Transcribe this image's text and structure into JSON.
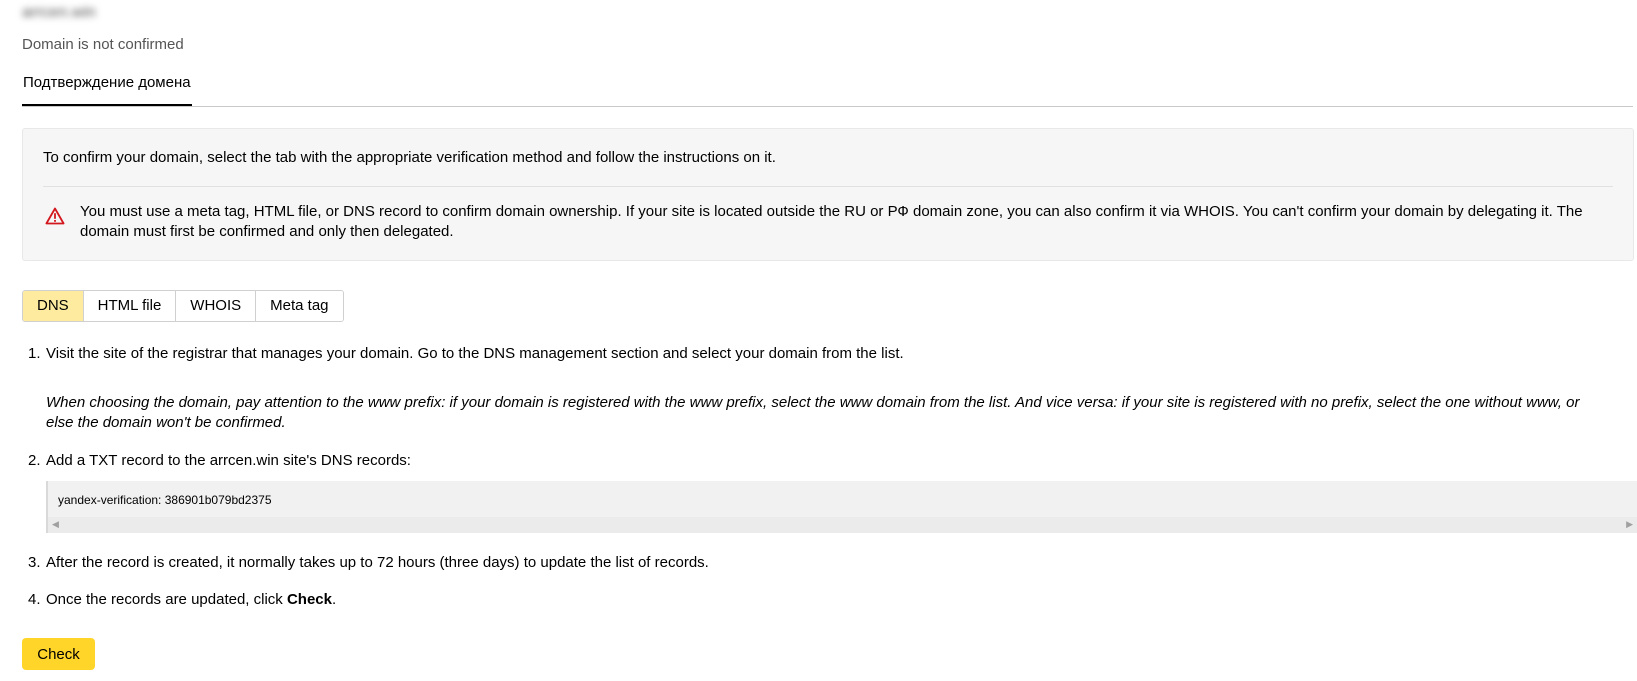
{
  "header": {
    "domain_name": "arrcen.win",
    "status": "Domain is not confirmed"
  },
  "tabs": [
    {
      "label": "Подтверждение домена",
      "active": true
    }
  ],
  "info": {
    "intro": "To confirm your domain, select the tab with the appropriate verification method and follow the instructions on it.",
    "warning_icon": "warning-triangle-icon",
    "warning": "You must use a meta tag, HTML file, or DNS record to confirm domain ownership. If your site is located outside the RU or РФ domain zone, you can also confirm it via WHOIS. You can't confirm your domain by delegating it. The domain must first be confirmed and only then delegated."
  },
  "methods": {
    "active": "DNS",
    "items": [
      "DNS",
      "HTML file",
      "WHOIS",
      "Meta tag"
    ]
  },
  "steps": {
    "s1_num": "1.",
    "s1_text": "Visit the site of the registrar that manages your domain. Go to the DNS management section and select your domain from the list.",
    "s1_note": "When choosing the domain, pay attention to the www prefix: if your domain is registered with the www prefix, select the www domain from the list. And vice versa: if your site is registered with no prefix, select the one without www, or else the domain won't be confirmed.",
    "s2_num": "2.",
    "s2_text": "Add a TXT record to the arrcen.win site's DNS records:",
    "s2_code": "yandex-verification: 386901b079bd2375",
    "s3_num": "3.",
    "s3_text": "After the record is created, it normally takes up to 72 hours (three days) to update the list of records.",
    "s4_num": "4.",
    "s4_text_before": "Once the records are updated, click ",
    "s4_text_bold": "Check",
    "s4_text_after": "."
  },
  "actions": {
    "check_label": "Check"
  },
  "colors": {
    "active_method_bg": "#ffeba0",
    "check_button_bg": "#ffd52a",
    "warning_icon": "#d3171e"
  }
}
